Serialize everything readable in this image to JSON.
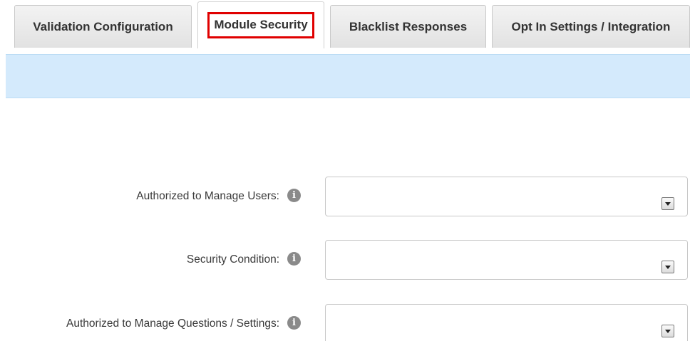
{
  "tabs": [
    {
      "label": "Validation Configuration",
      "active": false
    },
    {
      "label": "Module Security",
      "active": true
    },
    {
      "label": "Blacklist Responses",
      "active": false
    },
    {
      "label": "Opt In Settings / Integration",
      "active": false
    }
  ],
  "colors": {
    "info_bar": "#d4eafc",
    "highlight_border": "#e00000"
  },
  "form": {
    "fields": [
      {
        "label": "Authorized to Manage Users:",
        "value": "",
        "icon": "info-icon"
      },
      {
        "label": "Security Condition:",
        "value": "",
        "icon": "info-icon"
      },
      {
        "label": "Authorized to Manage Questions / Settings:",
        "value": "",
        "icon": "info-icon"
      }
    ]
  }
}
